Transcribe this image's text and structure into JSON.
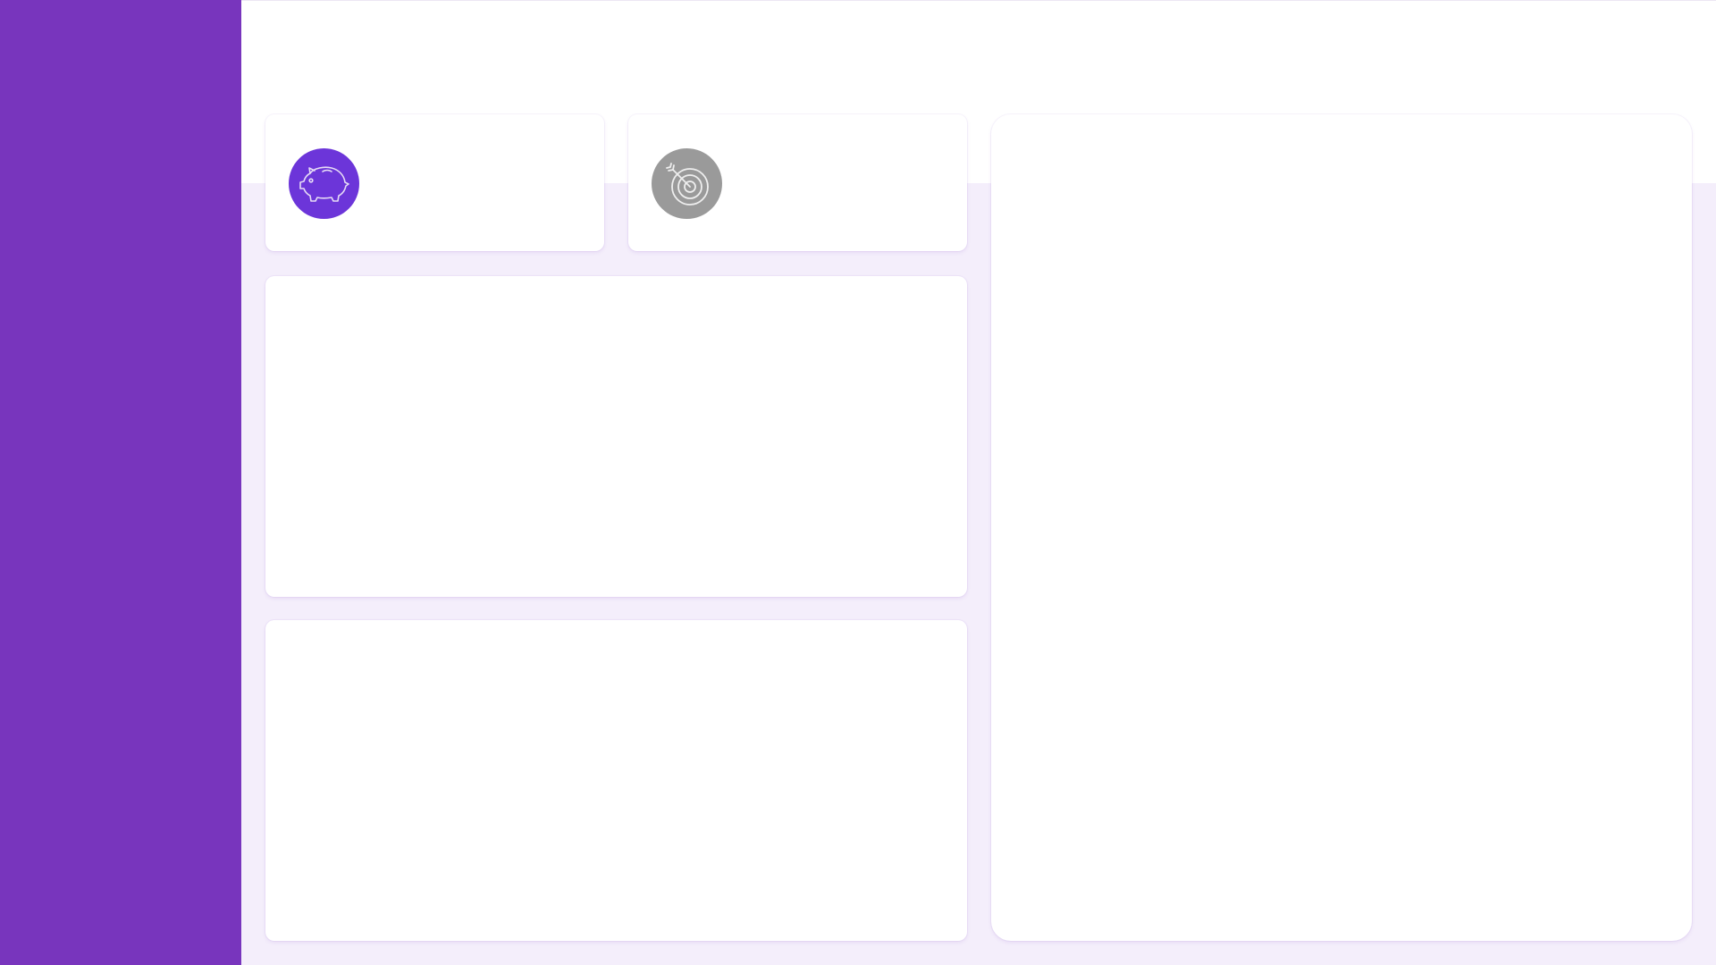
{
  "sidebar": {
    "background": "#7835bd"
  },
  "stat_cards": [
    {
      "icon": "piggy-bank-icon",
      "icon_bg": "#6c35d9"
    },
    {
      "icon": "target-icon",
      "icon_bg": "#9a9a9a"
    }
  ],
  "colors": {
    "page_bg": "#f4eefb",
    "card_bg": "#ffffff",
    "icon_stroke": "#e6dcf5"
  }
}
